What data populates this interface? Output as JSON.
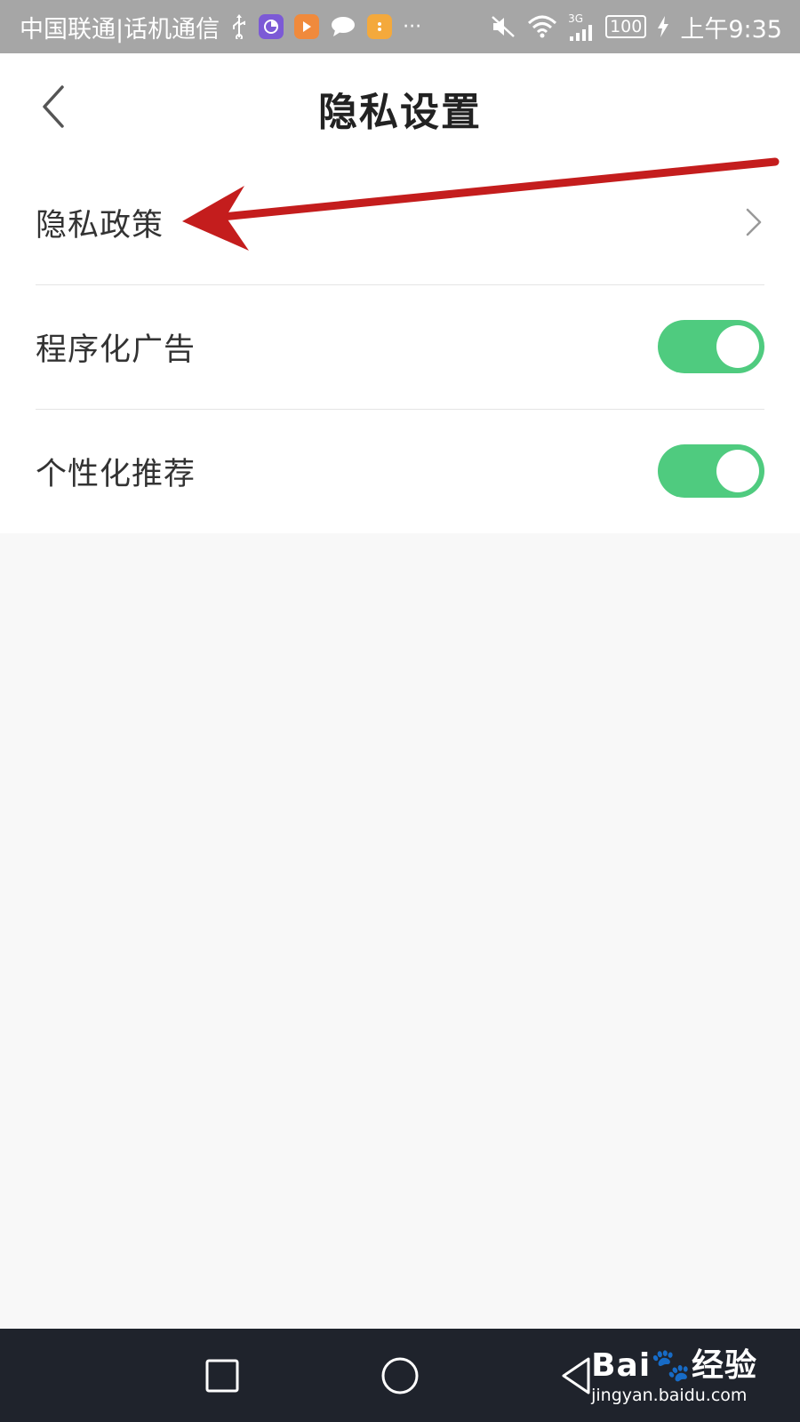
{
  "status_bar": {
    "carrier": "中国联通|话机通信",
    "network_type": "3G",
    "battery": "100",
    "time": "上午9:35",
    "icons": [
      "usb-icon",
      "app-purple-icon",
      "app-orange-icon",
      "chat-icon",
      "app-yellow-icon",
      "more-icon",
      "mute-icon",
      "wifi-icon",
      "signal-icon",
      "charging-icon"
    ],
    "colors": {
      "background": "#a6a6a6",
      "app_purple": "#7c5ad6",
      "app_orange": "#f08a3c",
      "app_yellow": "#f4a93c"
    }
  },
  "header": {
    "title": "隐私设置",
    "back_icon": "chevron-left-icon"
  },
  "settings": {
    "items": [
      {
        "label": "隐私政策",
        "control": "chevron",
        "icon": "chevron-right-icon"
      },
      {
        "label": "程序化广告",
        "control": "toggle",
        "on": true
      },
      {
        "label": "个性化推荐",
        "control": "toggle",
        "on": true
      }
    ],
    "toggle_on_color": "#4fcb7f"
  },
  "annotation": {
    "type": "arrow",
    "color": "#c41d1d",
    "points_to": "隐私政策"
  },
  "nav_bar": {
    "buttons": [
      "recent-apps-icon",
      "home-icon",
      "back-triangle-icon"
    ],
    "background": "#1f232c"
  },
  "watermark": {
    "logo_text": "Bai🐾经验",
    "url": "jingyan.baidu.com"
  }
}
